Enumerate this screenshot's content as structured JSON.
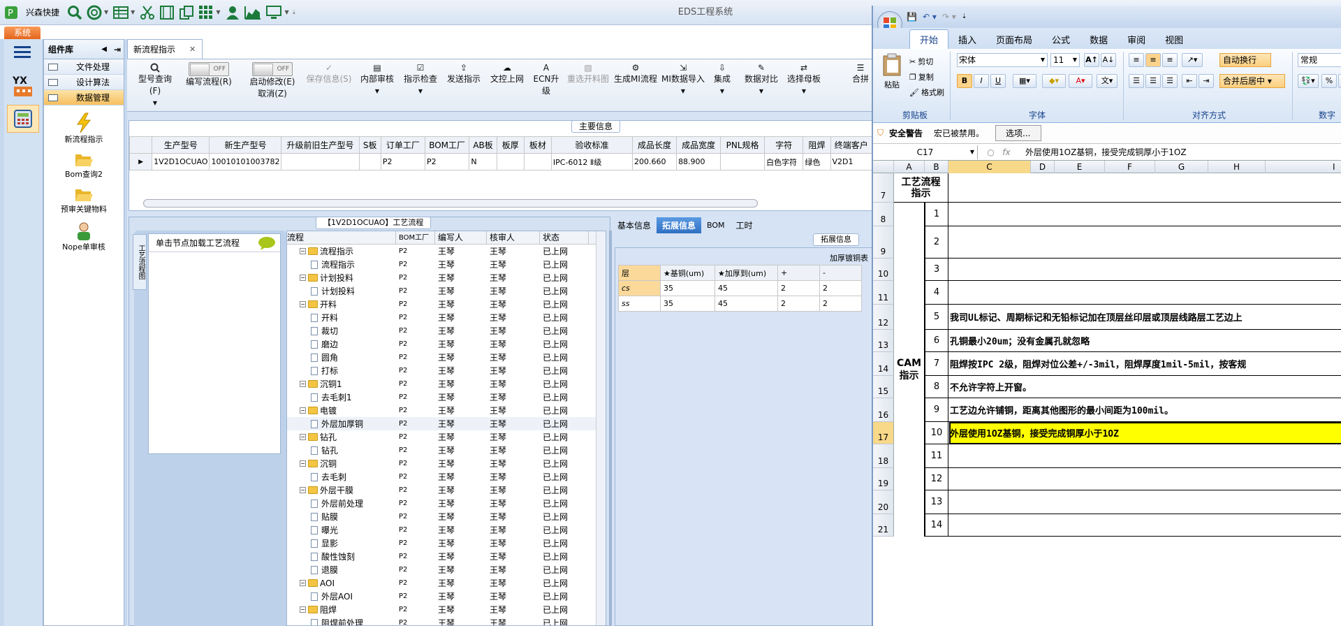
{
  "titlebar": {
    "app_name": "兴森快捷",
    "title": "EDS工程系统"
  },
  "sys_tab": "系统",
  "nav": {
    "header": "组件库",
    "items": [
      {
        "label": "文件处理"
      },
      {
        "label": "设计算法"
      },
      {
        "label": "数据管理"
      }
    ],
    "tools": [
      {
        "label": "新流程指示"
      },
      {
        "label": "Bom查询2"
      },
      {
        "label": "预审关键物料"
      },
      {
        "label": "Nope单审核"
      }
    ]
  },
  "doc_tab": "新流程指示",
  "toolbar": {
    "items": [
      {
        "label": "型号查询(F)"
      },
      {
        "label": "编写流程(R)",
        "toggle": "OFF"
      },
      {
        "label": "启动修改(E)",
        "label2": "取消(Z)",
        "toggle": "OFF"
      },
      {
        "label": "保存信息(S)"
      },
      {
        "label": "内部审核"
      },
      {
        "label": "指示检查"
      },
      {
        "label": "发送指示"
      },
      {
        "label": "文控上网"
      },
      {
        "label": "ECN升级"
      },
      {
        "label": "重选开料图"
      },
      {
        "label": "生成MI流程"
      },
      {
        "label": "MI数据导入"
      },
      {
        "label": "集成"
      },
      {
        "label": "数据对比"
      },
      {
        "label": "选择母板"
      },
      {
        "label": "合拼"
      }
    ]
  },
  "main_info": {
    "title": "主要信息",
    "columns": [
      "生产型号",
      "新生产型号",
      "升级前旧生产型号",
      "S板",
      "订单工厂",
      "BOM工厂",
      "AB板",
      "板厚",
      "板材",
      "验收标准",
      "成品长度",
      "成品宽度",
      "PNL规格",
      "字符",
      "阻焊",
      "终端客户"
    ],
    "row": [
      "1V2D1OCUAO",
      "10010101003782",
      "",
      "",
      "P2",
      "P2",
      "N",
      "",
      "",
      "IPC-6012 Ⅱ级",
      "200.660",
      "88.900",
      "",
      "白色字符",
      "绿色",
      "V2D1"
    ]
  },
  "process": {
    "title": "【1V2D1OCUAO】工艺流程",
    "side_tab": "工艺流程图",
    "node_hint": "单击节点加载工艺流程",
    "columns": [
      "流程",
      "BOM工厂",
      "编写人",
      "核审人",
      "状态"
    ],
    "rows": [
      {
        "name": "流程指示",
        "level": 0,
        "bom": "P2",
        "writer": "王琴",
        "checker": "王琴",
        "status": "已上网"
      },
      {
        "name": "流程指示",
        "level": 1,
        "bom": "P2",
        "writer": "王琴",
        "checker": "王琴",
        "status": "已上网"
      },
      {
        "name": "计划投料",
        "level": 0,
        "bom": "P2",
        "writer": "王琴",
        "checker": "王琴",
        "status": "已上网"
      },
      {
        "name": "计划投料",
        "level": 1,
        "bom": "P2",
        "writer": "王琴",
        "checker": "王琴",
        "status": "已上网"
      },
      {
        "name": "开料",
        "level": 0,
        "bom": "P2",
        "writer": "王琴",
        "checker": "王琴",
        "status": "已上网"
      },
      {
        "name": "开料",
        "level": 1,
        "bom": "P2",
        "writer": "王琴",
        "checker": "王琴",
        "status": "已上网"
      },
      {
        "name": "裁切",
        "level": 1,
        "bom": "P2",
        "writer": "王琴",
        "checker": "王琴",
        "status": "已上网"
      },
      {
        "name": "磨边",
        "level": 1,
        "bom": "P2",
        "writer": "王琴",
        "checker": "王琴",
        "status": "已上网"
      },
      {
        "name": "圆角",
        "level": 1,
        "bom": "P2",
        "writer": "王琴",
        "checker": "王琴",
        "status": "已上网"
      },
      {
        "name": "打标",
        "level": 1,
        "bom": "P2",
        "writer": "王琴",
        "checker": "王琴",
        "status": "已上网"
      },
      {
        "name": "沉铜1",
        "level": 0,
        "bom": "P2",
        "writer": "王琴",
        "checker": "王琴",
        "status": "已上网"
      },
      {
        "name": "去毛刺1",
        "level": 1,
        "bom": "P2",
        "writer": "王琴",
        "checker": "王琴",
        "status": "已上网"
      },
      {
        "name": "电镀",
        "level": 0,
        "bom": "P2",
        "writer": "王琴",
        "checker": "王琴",
        "status": "已上网"
      },
      {
        "name": "外层加厚铜",
        "level": 1,
        "bom": "P2",
        "writer": "王琴",
        "checker": "王琴",
        "status": "已上网"
      },
      {
        "name": "钻孔",
        "level": 0,
        "bom": "P2",
        "writer": "王琴",
        "checker": "王琴",
        "status": "已上网"
      },
      {
        "name": "钻孔",
        "level": 1,
        "bom": "P2",
        "writer": "王琴",
        "checker": "王琴",
        "status": "已上网"
      },
      {
        "name": "沉铜",
        "level": 0,
        "bom": "P2",
        "writer": "王琴",
        "checker": "王琴",
        "status": "已上网"
      },
      {
        "name": "去毛刺",
        "level": 1,
        "bom": "P2",
        "writer": "王琴",
        "checker": "王琴",
        "status": "已上网"
      },
      {
        "name": "外层干膜",
        "level": 0,
        "bom": "P2",
        "writer": "王琴",
        "checker": "王琴",
        "status": "已上网"
      },
      {
        "name": "外层前处理",
        "level": 1,
        "bom": "P2",
        "writer": "王琴",
        "checker": "王琴",
        "status": "已上网"
      },
      {
        "name": "贴膜",
        "level": 1,
        "bom": "P2",
        "writer": "王琴",
        "checker": "王琴",
        "status": "已上网"
      },
      {
        "name": "曝光",
        "level": 1,
        "bom": "P2",
        "writer": "王琴",
        "checker": "王琴",
        "status": "已上网"
      },
      {
        "name": "显影",
        "level": 1,
        "bom": "P2",
        "writer": "王琴",
        "checker": "王琴",
        "status": "已上网"
      },
      {
        "name": "酸性蚀刻",
        "level": 1,
        "bom": "P2",
        "writer": "王琴",
        "checker": "王琴",
        "status": "已上网"
      },
      {
        "name": "退膜",
        "level": 1,
        "bom": "P2",
        "writer": "王琴",
        "checker": "王琴",
        "status": "已上网"
      },
      {
        "name": "AOI",
        "level": 0,
        "bom": "P2",
        "writer": "王琴",
        "checker": "王琴",
        "status": "已上网"
      },
      {
        "name": "外层AOI",
        "level": 1,
        "bom": "P2",
        "writer": "王琴",
        "checker": "王琴",
        "status": "已上网"
      },
      {
        "name": "阻焊",
        "level": 0,
        "bom": "P2",
        "writer": "王琴",
        "checker": "王琴",
        "status": "已上网"
      },
      {
        "name": "阻焊前处理",
        "level": 1,
        "bom": "P2",
        "writer": "王琴",
        "checker": "王琴",
        "status": "已上网"
      }
    ]
  },
  "info": {
    "tabs": [
      "基本信息",
      "拓展信息",
      "BOM",
      "工时"
    ],
    "active": "拓展信息",
    "group": "拓展信息",
    "table_title": "加厚镀铜表",
    "columns": [
      "层",
      "★基铜(um)",
      "★加厚到(um)",
      "+",
      "-"
    ],
    "rows": [
      [
        "cs",
        "35",
        "45",
        "2",
        "2"
      ],
      [
        "ss",
        "35",
        "45",
        "2",
        "2"
      ]
    ]
  },
  "excel": {
    "tabs": [
      "开始",
      "插入",
      "页面布局",
      "公式",
      "数据",
      "审阅",
      "视图"
    ],
    "clipboard": {
      "paste": "粘贴",
      "cut": "剪切",
      "copy": "复制",
      "format": "格式刷",
      "group": "剪贴板"
    },
    "font": {
      "name": "宋体",
      "size": "11",
      "group": "字体"
    },
    "align": {
      "wrap": "自动换行",
      "merge": "合并后居中",
      "group": "对齐方式"
    },
    "number": {
      "format": "常规",
      "group": "数字"
    },
    "security": {
      "label": "安全警告",
      "text": "宏已被禁用。",
      "button": "选项..."
    },
    "cell_ref": "C17",
    "formula": "外层使用1OZ基铜，接受完成铜厚小于1OZ",
    "columns": [
      "A",
      "B",
      "C",
      "D",
      "E",
      "F",
      "G",
      "H",
      "I"
    ],
    "a7": "工艺流程指示",
    "a_cam": "CAM指示",
    "rows": [
      {
        "row": "7",
        "b": "",
        "text": ""
      },
      {
        "row": "8",
        "b": "1",
        "text": ""
      },
      {
        "row": "9",
        "b": "2",
        "text": ""
      },
      {
        "row": "10",
        "b": "3",
        "text": ""
      },
      {
        "row": "11",
        "b": "4",
        "text": ""
      },
      {
        "row": "12",
        "b": "5",
        "text": "我司UL标记、周期标记和无铅标记加在顶层丝印层或顶层线路层工艺边上"
      },
      {
        "row": "13",
        "b": "6",
        "text": "孔铜最小20um；没有金属孔就忽略"
      },
      {
        "row": "14",
        "b": "7",
        "text": "阻焊按IPC 2级，阻焊对位公差+/-3mil，阻焊厚度1mil-5mil，按客规"
      },
      {
        "row": "15",
        "b": "8",
        "text": "不允许字符上开窗。"
      },
      {
        "row": "16",
        "b": "9",
        "text": "工艺边允许铺铜，距离其他图形的最小间距为100mil。"
      },
      {
        "row": "17",
        "b": "10",
        "text": "外层使用1OZ基铜，接受完成铜厚小于1OZ"
      },
      {
        "row": "18",
        "b": "11",
        "text": ""
      },
      {
        "row": "19",
        "b": "12",
        "text": ""
      },
      {
        "row": "20",
        "b": "13",
        "text": ""
      },
      {
        "row": "21",
        "b": "14",
        "text": ""
      }
    ]
  }
}
